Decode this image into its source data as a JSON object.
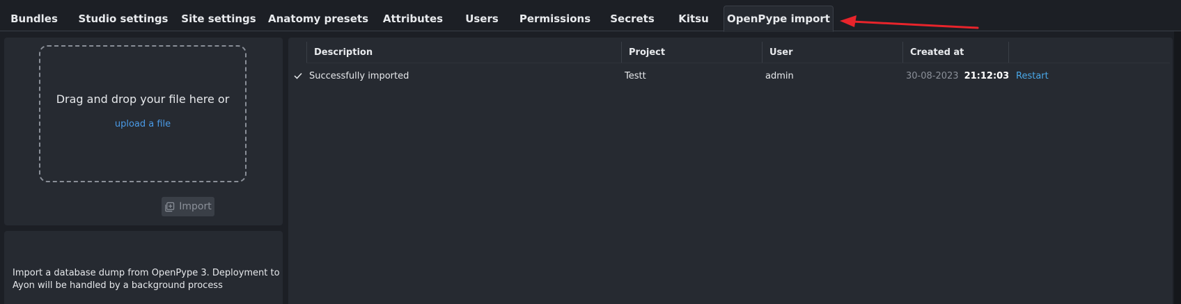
{
  "tabs": [
    {
      "label": "Bundles"
    },
    {
      "label": "Studio settings"
    },
    {
      "label": "Site settings"
    },
    {
      "label": "Anatomy presets"
    },
    {
      "label": "Attributes"
    },
    {
      "label": "Users"
    },
    {
      "label": "Permissions"
    },
    {
      "label": "Secrets"
    },
    {
      "label": "Kitsu"
    },
    {
      "label": "OpenPype import",
      "active": true
    }
  ],
  "upload": {
    "drop_text": "Drag and drop your file here or",
    "upload_link": "upload a file",
    "import_label": "Import",
    "import_icon": "import-icon"
  },
  "info": {
    "text": "Import a database dump from OpenPype 3. Deployment to Ayon will be handled by a background process"
  },
  "table": {
    "headers": [
      "Description",
      "Project",
      "User",
      "Created at"
    ],
    "rows": [
      {
        "status_icon": "check-icon",
        "description": "Successfully imported",
        "project": "Testt",
        "user": "admin",
        "date": "30-08-2023",
        "time": "21:12:03",
        "action": "Restart"
      }
    ]
  },
  "colors": {
    "background": "#1c1f25",
    "panel": "#262a31",
    "link": "#4a9be8",
    "annotation_arrow": "#e8242b"
  }
}
